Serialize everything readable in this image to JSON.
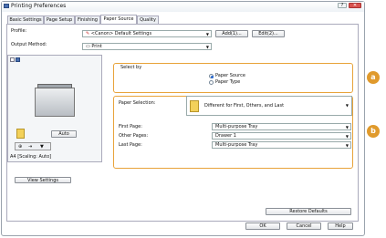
{
  "window": {
    "title": "Printing Preferences",
    "help_glyph": "?",
    "close_glyph": "✕"
  },
  "tabs": [
    "Basic Settings",
    "Page Setup",
    "Finishing",
    "Paper Source",
    "Quality"
  ],
  "profile": {
    "label": "Profile:",
    "value": "<Canon> Default Settings",
    "add_label": "Add(1)...",
    "edit_label": "Edit(2)..."
  },
  "output": {
    "label": "Output Method:",
    "value": "Print"
  },
  "select_by": {
    "legend": "Select by",
    "options": [
      "Paper Source",
      "Paper Type"
    ],
    "selected_index": 0
  },
  "paper_selection": {
    "label": "Paper Selection:",
    "value": "Different for First, Others, and Last"
  },
  "first_page": {
    "label": "First Page:",
    "value": "Multi-purpose Tray"
  },
  "other_pages": {
    "label": "Other Pages:",
    "value": "Drawer 1"
  },
  "last_page": {
    "label": "Last Page:",
    "value": "Multi-purpose Tray"
  },
  "preview": {
    "auto_label": "Auto",
    "caption": "A4 [Scaling: Auto]"
  },
  "view_settings_label": "View Settings",
  "restore_defaults_label": "Restore Defaults",
  "footer": {
    "ok": "OK",
    "cancel": "Cancel",
    "help": "Help"
  },
  "badges": {
    "a": "a",
    "b": "b"
  },
  "colors": {
    "accent_orange": "#E8A33A",
    "badge_orange": "#E09A2C"
  }
}
